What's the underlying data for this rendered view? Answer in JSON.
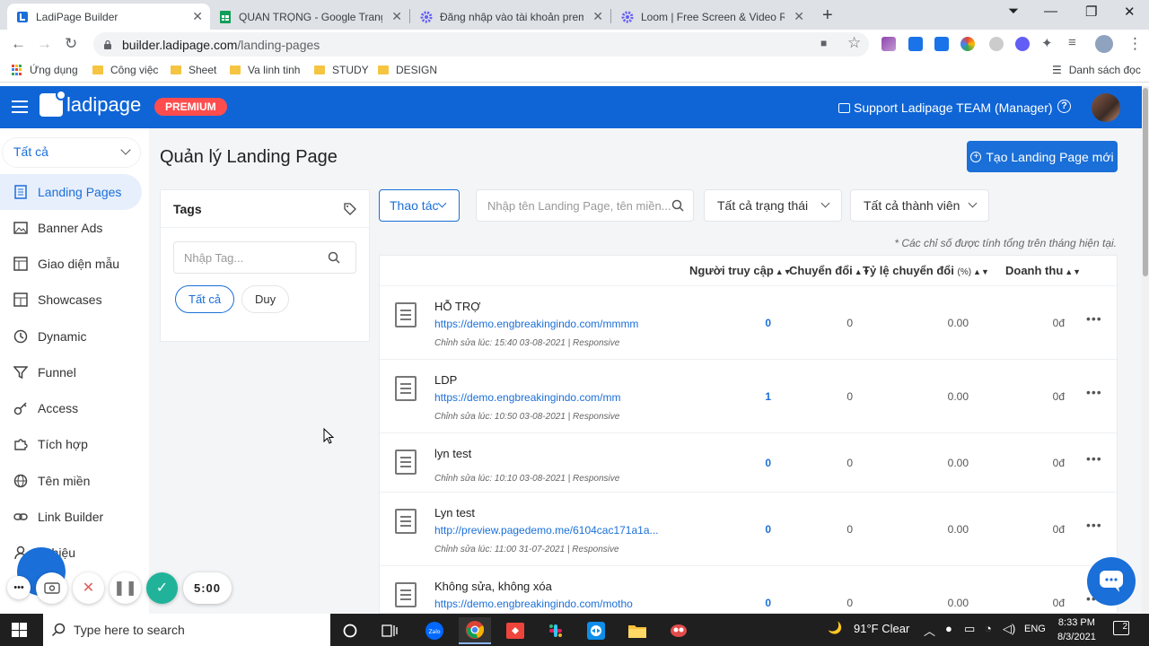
{
  "browser": {
    "tabs": [
      {
        "title": "LadiPage Builder",
        "active": true
      },
      {
        "title": "QUAN TRỌNG - Google Trang tính",
        "active": false
      },
      {
        "title": "Đăng nhập vào tài khoản premium",
        "active": false
      },
      {
        "title": "Loom | Free Screen & Video Recording",
        "active": false
      }
    ],
    "url_host": "builder.ladipage.com",
    "url_path": "/landing-pages",
    "bookmarks": [
      "Ứng dụng",
      "Công việc",
      "Sheet",
      "Va linh tinh",
      "STUDY",
      "DESIGN"
    ],
    "reading_list": "Danh sách đọc"
  },
  "header": {
    "logo_text": "ladipage",
    "badge": "PREMIUM",
    "support_label": "Support Ladipage TEAM (Manager)",
    "help": "?",
    "colors": {
      "header_bg": "#0f65d6",
      "badge_bg": "#ff4d4d",
      "accent": "#1a6fd8"
    }
  },
  "sidebar": {
    "filter_value": "Tất cả",
    "items": [
      {
        "label": "Landing Pages",
        "icon": "document-icon",
        "active": true
      },
      {
        "label": "Banner Ads",
        "icon": "image-icon"
      },
      {
        "label": "Giao diện mẫu",
        "icon": "layout-icon"
      },
      {
        "label": "Showcases",
        "icon": "showcase-icon"
      },
      {
        "label": "Dynamic",
        "icon": "dynamic-icon"
      },
      {
        "label": "Funnel",
        "icon": "funnel-icon"
      },
      {
        "label": "Access",
        "icon": "key-icon"
      },
      {
        "label": "Tích hợp",
        "icon": "puzzle-icon"
      },
      {
        "label": "Tên miền",
        "icon": "globe-icon"
      },
      {
        "label": "Link Builder",
        "icon": "link-icon"
      },
      {
        "label": "...thiệu",
        "icon": "user-icon"
      }
    ]
  },
  "main": {
    "title": "Quản lý Landing Page",
    "create_button": "Tạo Landing Page mới",
    "tags": {
      "title": "Tags",
      "placeholder": "Nhập Tag...",
      "chips": [
        "Tất cả",
        "Duy"
      ]
    },
    "action_button": "Thao tác",
    "search_placeholder": "Nhập tên Landing Page, tên miền...",
    "status_filter": "Tất cả trạng thái",
    "member_filter": "Tất cả thành viên",
    "note": "* Các chỉ số được tính tổng trên tháng hiện tại.",
    "columns": {
      "visits": "Người truy cập",
      "conversions": "Chuyển đổi",
      "rate": "Tỷ lệ chuyển đổi",
      "rate_unit": "(%)",
      "revenue": "Doanh thu"
    },
    "rows": [
      {
        "name": "HỖ TRỢ",
        "url": "https://demo.engbreakingindo.com/mmmm",
        "edited": "Chỉnh sửa lúc: 15:40 03-08-2021 | Responsive",
        "visits": "0",
        "conversions": "0",
        "rate": "0.00",
        "revenue": "0đ"
      },
      {
        "name": "LDP",
        "url": "https://demo.engbreakingindo.com/mm",
        "edited": "Chỉnh sửa lúc: 10:50 03-08-2021 | Responsive",
        "visits": "1",
        "conversions": "0",
        "rate": "0.00",
        "revenue": "0đ"
      },
      {
        "name": "lyn test",
        "url": "",
        "edited": "Chỉnh sửa lúc: 10:10 03-08-2021 | Responsive",
        "visits": "0",
        "conversions": "0",
        "rate": "0.00",
        "revenue": "0đ"
      },
      {
        "name": "Lyn test",
        "url": "http://preview.pagedemo.me/6104cac171a1a...",
        "edited": "Chỉnh sửa lúc: 11:00 31-07-2021 | Responsive",
        "visits": "0",
        "conversions": "0",
        "rate": "0.00",
        "revenue": "0đ"
      },
      {
        "name": "Không sửa, không xóa",
        "url": "https://demo.engbreakingindo.com/motho",
        "edited": "",
        "visits": "0",
        "conversions": "0",
        "rate": "0.00",
        "revenue": "0đ"
      }
    ]
  },
  "loom": {
    "timer": "5:00"
  },
  "taskbar": {
    "search_placeholder": "Type here to search",
    "weather": "91°F  Clear",
    "lang": "ENG",
    "time": "8:33 PM",
    "date": "8/3/2021",
    "notifications": "2"
  }
}
